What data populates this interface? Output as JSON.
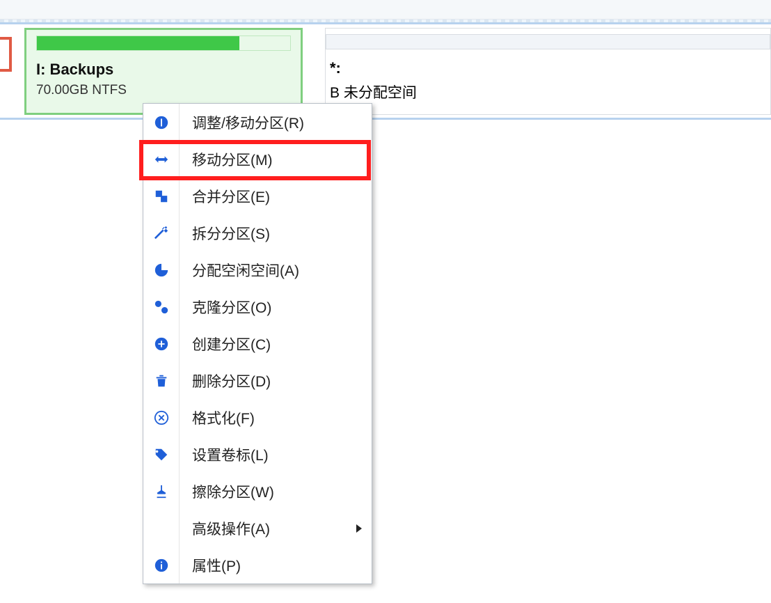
{
  "partition": {
    "title": "I: Backups",
    "detail": "70.00GB NTFS",
    "usage_percent": 80
  },
  "unallocated": {
    "drive": "*:",
    "detail": "B 未分配空间"
  },
  "menu": {
    "resize": {
      "label": "调整/移动分区(R)"
    },
    "move": {
      "label": "移动分区(M)"
    },
    "merge": {
      "label": "合并分区(E)"
    },
    "split": {
      "label": "拆分分区(S)"
    },
    "alloc": {
      "label": "分配空闲空间(A)"
    },
    "clone": {
      "label": "克隆分区(O)"
    },
    "create": {
      "label": "创建分区(C)"
    },
    "delete": {
      "label": "删除分区(D)"
    },
    "format": {
      "label": "格式化(F)"
    },
    "label": {
      "label": "设置卷标(L)"
    },
    "wipe": {
      "label": "擦除分区(W)"
    },
    "advanced": {
      "label": "高级操作(A)"
    },
    "props": {
      "label": "属性(P)"
    }
  }
}
